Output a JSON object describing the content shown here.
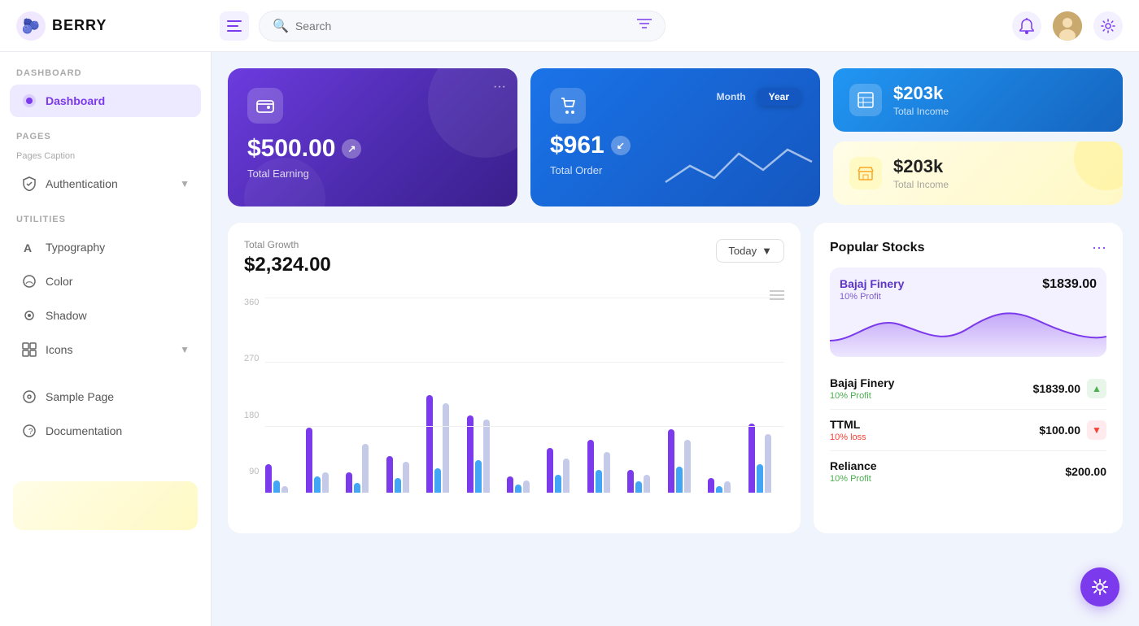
{
  "app": {
    "name": "BERRY",
    "logo_emoji": "🫐"
  },
  "topbar": {
    "search_placeholder": "Search",
    "bell_icon": "🔔",
    "settings_icon": "⚙",
    "avatar_emoji": "👤"
  },
  "sidebar": {
    "section_dashboard": "Dashboard",
    "item_dashboard": "Dashboard",
    "section_pages": "Pages",
    "pages_caption": "Pages Caption",
    "item_authentication": "Authentication",
    "section_utilities": "Utilities",
    "item_typography": "Typography",
    "item_color": "Color",
    "item_shadow": "Shadow",
    "item_icons": "Icons",
    "item_sample_page": "Sample Page",
    "item_documentation": "Documentation"
  },
  "cards": {
    "earning": {
      "amount": "$500.00",
      "label": "Total Earning",
      "icon": "💳"
    },
    "order": {
      "amount": "$961",
      "label": "Total Order",
      "tab_month": "Month",
      "tab_year": "Year"
    },
    "income_blue": {
      "amount": "$203k",
      "label": "Total Income",
      "icon": "📊"
    },
    "income_yellow": {
      "amount": "$203k",
      "label": "Total Income",
      "icon": "🏪"
    }
  },
  "chart": {
    "title": "Total Growth",
    "amount": "$2,324.00",
    "filter_label": "Today",
    "y_labels": [
      "360",
      "270",
      "180",
      "90"
    ],
    "bars": [
      {
        "purple": 35,
        "blue": 15,
        "light": 8
      },
      {
        "purple": 80,
        "blue": 20,
        "light": 25
      },
      {
        "purple": 25,
        "blue": 12,
        "light": 60
      },
      {
        "purple": 45,
        "blue": 18,
        "light": 38
      },
      {
        "purple": 120,
        "blue": 30,
        "light": 110
      },
      {
        "purple": 95,
        "blue": 40,
        "light": 90
      },
      {
        "purple": 20,
        "blue": 10,
        "light": 15
      },
      {
        "purple": 55,
        "blue": 22,
        "light": 42
      },
      {
        "purple": 65,
        "blue": 28,
        "light": 50
      },
      {
        "purple": 28,
        "blue": 14,
        "light": 22
      },
      {
        "purple": 78,
        "blue": 32,
        "light": 65
      },
      {
        "purple": 18,
        "blue": 8,
        "light": 14
      },
      {
        "purple": 85,
        "blue": 35,
        "light": 72
      }
    ]
  },
  "stocks": {
    "title": "Popular Stocks",
    "featured": {
      "name": "Bajaj Finery",
      "profit_label": "10% Profit",
      "value": "$1839.00"
    },
    "items": [
      {
        "name": "Bajaj Finery",
        "profit": "10% Profit",
        "profit_type": "up",
        "price": "$1839.00"
      },
      {
        "name": "TTML",
        "profit": "10% loss",
        "profit_type": "down",
        "price": "$100.00"
      },
      {
        "name": "Reliance",
        "profit": "10% Profit",
        "profit_type": "up",
        "price": "$200.00"
      }
    ]
  },
  "fab": {
    "icon": "⚙"
  }
}
